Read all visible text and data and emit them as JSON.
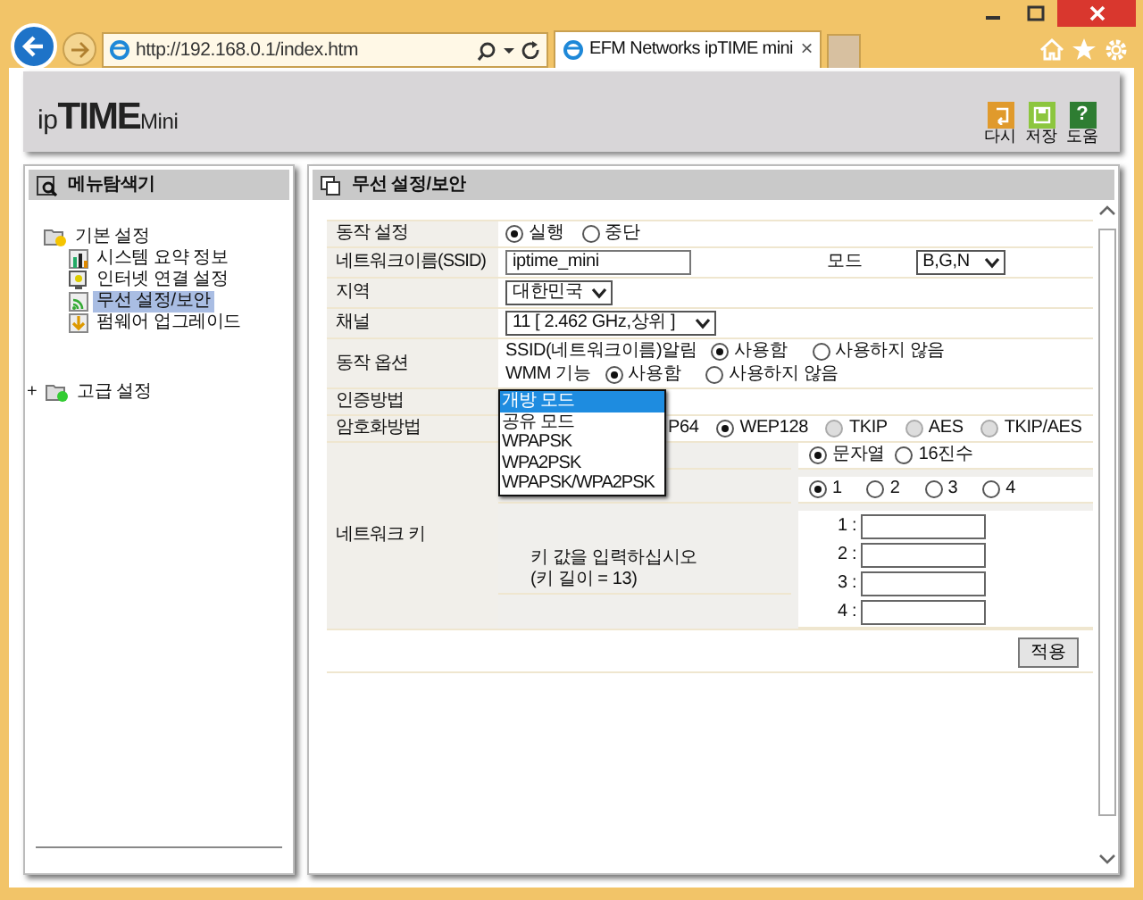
{
  "browser": {
    "address": "http://192.168.0.1/index.htm",
    "tab": {
      "title": "EFM Networks ipTIME mini",
      "close": "×"
    }
  },
  "header": {
    "logo": {
      "prefix": "ip",
      "main": "TIME",
      "suffix": "Mini"
    },
    "tools": [
      {
        "kind": "reload",
        "label": "다시",
        "color": "#e09a2c"
      },
      {
        "kind": "save",
        "label": "저장",
        "color": "#8cc63e"
      },
      {
        "kind": "help",
        "label": "도움",
        "color": "#2e7d32",
        "glyph": "?"
      }
    ]
  },
  "sidebar": {
    "title": "메뉴탐색기",
    "items": [
      {
        "label": "기본 설정",
        "expanded": true,
        "children": [
          {
            "label": "시스템 요약 정보",
            "kind": "chart",
            "selected": false
          },
          {
            "label": "인터넷 연결 설정",
            "kind": "monitor",
            "selected": false
          },
          {
            "label": "무선 설정/보안",
            "kind": "wireless",
            "selected": true
          },
          {
            "label": "펌웨어 업그레이드",
            "kind": "firmware",
            "selected": false
          }
        ]
      },
      {
        "label": "고급 설정",
        "expanded": false,
        "toggle": "+"
      }
    ]
  },
  "panel": {
    "title": "무선 설정/보안",
    "rows": [
      {
        "kind": "radio",
        "label": "동작 설정",
        "options": [
          {
            "label": "실행",
            "selected": true,
            "disabled": false
          },
          {
            "label": "중단",
            "selected": false,
            "disabled": false
          }
        ]
      },
      {
        "kind": "ssid",
        "label": "네트워크이름(SSID)",
        "value": "iptime_mini",
        "mode_label": "모드",
        "mode": "B,G,N"
      },
      {
        "kind": "select",
        "label": "지역",
        "value": "대한민국"
      },
      {
        "kind": "select",
        "label": "채널",
        "value": "11 [ 2.462 GHz,상위 ]"
      },
      {
        "kind": "options",
        "label": "동작 옵션",
        "lines": [
          {
            "label": "SSID(네트워크이름)알림",
            "options": [
              {
                "label": "사용함",
                "selected": true,
                "disabled": false
              },
              {
                "label": "사용하지 않음",
                "selected": false,
                "disabled": false
              }
            ]
          },
          {
            "label": "WMM 기능",
            "options": [
              {
                "label": "사용함",
                "selected": true,
                "disabled": false
              },
              {
                "label": "사용하지 않음",
                "selected": false,
                "disabled": false
              }
            ]
          }
        ]
      },
      {
        "kind": "dropdown",
        "label": "인증방법",
        "items": [
          {
            "label": "개방 모드",
            "selected": true
          },
          {
            "label": "공유 모드",
            "selected": false
          },
          {
            "label": "WPAPSK",
            "selected": false
          },
          {
            "label": "WPA2PSK",
            "selected": false
          },
          {
            "label": "WPAPSK/WPA2PSK",
            "selected": false
          }
        ]
      },
      {
        "kind": "radio",
        "label": "암호화방법",
        "options": [
          {
            "label": "P64",
            "clipped": true
          },
          {
            "label": "WEP128",
            "selected": true,
            "disabled": false
          },
          {
            "label": "TKIP",
            "selected": false,
            "disabled": true
          },
          {
            "label": "AES",
            "selected": false,
            "disabled": true
          },
          {
            "label": "TKIP/AES",
            "selected": false,
            "disabled": true
          }
        ]
      },
      {
        "kind": "key",
        "label": "네트워크 키",
        "format": [
          {
            "label": "문자열",
            "selected": true,
            "disabled": false
          },
          {
            "label": "16진수",
            "selected": false,
            "disabled": false
          }
        ],
        "index": [
          {
            "label": "1",
            "selected": true,
            "disabled": false
          },
          {
            "label": "2",
            "selected": false,
            "disabled": false
          },
          {
            "label": "3",
            "selected": false,
            "disabled": false
          },
          {
            "label": "4",
            "selected": false,
            "disabled": false
          }
        ],
        "prompt": "키 값을 입력하십시오",
        "length": "(키 길이 = 13)",
        "keys": [
          "1 :",
          "2 :",
          "3 :",
          "4 :"
        ]
      }
    ],
    "apply": "적용"
  }
}
